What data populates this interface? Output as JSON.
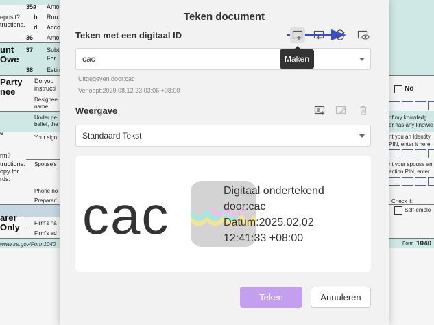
{
  "dialog": {
    "title": "Teken document",
    "digital_id": {
      "label": "Teken met een digitaal ID",
      "selected": "cac",
      "issued_by": "Uitgegeven door:cac",
      "expires": "Verloopt:2029.08.12 23:03:06 +08:00",
      "tooltip": "Maken"
    },
    "appearance": {
      "label": "Weergave",
      "selected": "Standaard Tekst"
    },
    "preview": {
      "name": "cac",
      "line1": "Digitaal ondertekend",
      "line2": "door:cac",
      "line3": "Datum:2025.02.02",
      "line4": "12:41:33 +08:00"
    },
    "buttons": {
      "sign": "Teken",
      "cancel": "Annuleren"
    }
  },
  "background_form": {
    "left": [
      {
        "num": "35a",
        "text": "Amo"
      },
      {
        "num": "b",
        "text": "Rou"
      },
      {
        "num": "d",
        "text": "Acco"
      },
      {
        "num": "36",
        "text": "Amo"
      },
      {
        "num": "37",
        "text": "Subt"
      },
      {
        "text": "For"
      },
      {
        "num": "38",
        "text": "Estin"
      }
    ],
    "left_margin": [
      "eposit?",
      "tructions.",
      "e",
      "rm?",
      "tructions.",
      "opy for",
      "rds."
    ],
    "section_owe": [
      "unt",
      "Owe"
    ],
    "section_party": [
      "Party",
      "nee"
    ],
    "section_preparer": [
      "arer",
      "Only"
    ],
    "party_lines": [
      "Do you",
      "instructi",
      "Designee",
      "name",
      "Under pe",
      "belief, the",
      "Your sign",
      "Spouse's",
      "Phone no",
      "Preparer'",
      "Firm's na",
      "Firm's ad"
    ],
    "footer_url": "www.irs.gov/Form1040",
    "right": [
      "No",
      "of my knowledg",
      "er has any knowle",
      "nt you an Identity",
      "PIN, enter it here",
      "nt your spouse an",
      "ection PIN, enter",
      "Check if:",
      "Self-emplo"
    ],
    "form_label": "Form",
    "form_number": "1040"
  }
}
